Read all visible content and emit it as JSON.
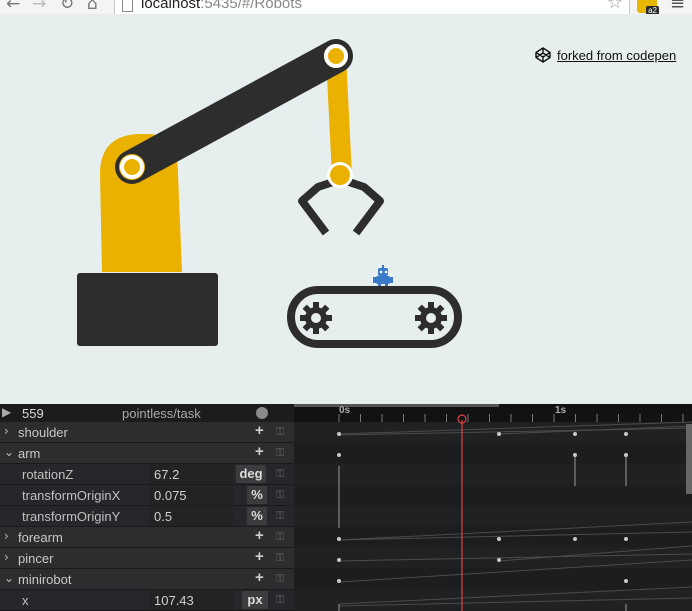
{
  "browser": {
    "url_host": "localhost",
    "url_rest": ":5435/#/Robots",
    "ext_badge": "a2",
    "icons": [
      "back-arrow-icon",
      "forward-arrow-icon",
      "reload-icon",
      "home-icon",
      "page-icon",
      "star-icon",
      "extension-icon",
      "menu-icon"
    ]
  },
  "stage": {
    "codepen_label": "forked from codepen",
    "colors": {
      "background": "#e6eeee",
      "robot_yellow": "#eab100",
      "robot_dark": "#2d2d2d",
      "minirobot_blue": "#3a79c8"
    }
  },
  "timeline": {
    "frame": "559",
    "task": "pointless/task",
    "ruler_labels": [
      "0s",
      "1s"
    ],
    "playhead_color": "#e0413f",
    "rows": [
      {
        "type": "group",
        "label": "shoulder",
        "open": false
      },
      {
        "type": "group",
        "label": "arm",
        "open": true
      },
      {
        "type": "prop",
        "label": "rotationZ",
        "value": "67.2",
        "unit": "deg"
      },
      {
        "type": "prop",
        "label": "transformOriginX",
        "value": "0.075",
        "unit": "%"
      },
      {
        "type": "prop",
        "label": "transformOriginY",
        "value": "0.5",
        "unit": "%"
      },
      {
        "type": "group",
        "label": "forearm",
        "open": false
      },
      {
        "type": "group",
        "label": "pincer",
        "open": false
      },
      {
        "type": "group",
        "label": "minirobot",
        "open": true
      },
      {
        "type": "prop",
        "label": "x",
        "value": "107.43",
        "unit": "px"
      }
    ]
  }
}
